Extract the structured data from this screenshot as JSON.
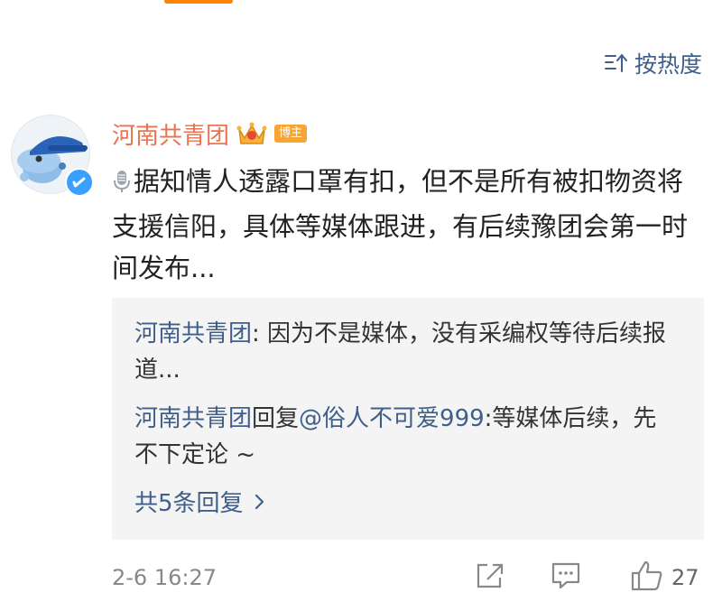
{
  "sort": {
    "label": "按热度"
  },
  "comment": {
    "username": "河南共青团",
    "badge": "博主",
    "text": "据知情人透露口罩有扣，但不是所有被扣物资将支援信阳，具体等媒体跟进，有后续豫团会第一时间发布...",
    "timestamp": "2-6 16:27",
    "likes": "27"
  },
  "replies": [
    {
      "author": "河南共青团",
      "separator": ": ",
      "text": "因为不是媒体，没有采编权等待后续报道..."
    },
    {
      "author": "河南共青团",
      "verb": "回复",
      "mention": "@俗人不可爱999",
      "text": ":等媒体后续，先不下定论 ~"
    }
  ],
  "more_replies": {
    "label": "共5条回复"
  },
  "colors": {
    "username": "#eb7350",
    "link": "#3f5f8a",
    "badge": "#f7a534",
    "reply_bg": "#f4f4f4",
    "verified": "#3aa0ff"
  },
  "icons": {
    "sort": "sort-icon",
    "crown": "crown-icon",
    "mic": "microphone-icon",
    "verified": "verified-icon",
    "chevron": "chevron-right-icon",
    "share": "share-icon",
    "comment": "comment-icon",
    "like": "thumbs-up-icon"
  }
}
